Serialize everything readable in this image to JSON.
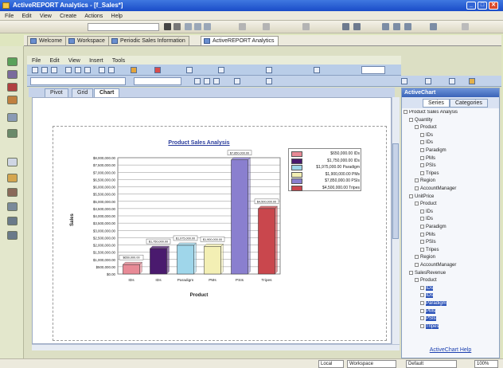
{
  "window": {
    "title": "ActiveREPORT Analytics - [f_Sales*]",
    "controls": [
      "_",
      "□",
      "✕"
    ]
  },
  "menubar": [
    "File",
    "Edit",
    "View",
    "Create",
    "Actions",
    "Help"
  ],
  "doc_tabs": [
    {
      "label": "Welcome"
    },
    {
      "label": "Workspace"
    },
    {
      "label": "Periodic Sales Information"
    },
    {
      "label": "ActiveREPORT Analytics"
    }
  ],
  "inner_menu": [
    "File",
    "Edit",
    "View",
    "Insert",
    "Tools"
  ],
  "view_tabs": [
    "Pivot",
    "Grid",
    "Chart"
  ],
  "active_view": "Chart",
  "right_panel": {
    "title": "ActiveChart",
    "tabs": [
      "Series",
      "Categories"
    ],
    "link": "ActiveChart Help"
  },
  "tree": [
    {
      "label": "Product Sales Analysis",
      "level": 0,
      "sel": false
    },
    {
      "label": "Quantity",
      "level": 1,
      "sel": false
    },
    {
      "label": "Product",
      "level": 2,
      "sel": false
    },
    {
      "label": "IDs",
      "level": 3,
      "sel": false
    },
    {
      "label": "IDs",
      "level": 3,
      "sel": false
    },
    {
      "label": "Paradigm",
      "level": 3,
      "sel": false
    },
    {
      "label": "PMs",
      "level": 3,
      "sel": false
    },
    {
      "label": "PSIs",
      "level": 3,
      "sel": false
    },
    {
      "label": "Tripes",
      "level": 3,
      "sel": false
    },
    {
      "label": "Region",
      "level": 2,
      "sel": false
    },
    {
      "label": "AccountManager",
      "level": 2,
      "sel": false
    },
    {
      "label": "UnitPrice",
      "level": 1,
      "sel": false
    },
    {
      "label": "Product",
      "level": 2,
      "sel": false
    },
    {
      "label": "IDs",
      "level": 3,
      "sel": false
    },
    {
      "label": "IDs",
      "level": 3,
      "sel": false
    },
    {
      "label": "Paradigm",
      "level": 3,
      "sel": false
    },
    {
      "label": "PMs",
      "level": 3,
      "sel": false
    },
    {
      "label": "PSIs",
      "level": 3,
      "sel": false
    },
    {
      "label": "Tripes",
      "level": 3,
      "sel": false
    },
    {
      "label": "Region",
      "level": 2,
      "sel": false
    },
    {
      "label": "AccountManager",
      "level": 2,
      "sel": false
    },
    {
      "label": "SalesRevenue",
      "level": 1,
      "sel": false
    },
    {
      "label": "Product",
      "level": 2,
      "sel": false
    },
    {
      "label": "IDs",
      "level": 3,
      "sel": true
    },
    {
      "label": "IDs",
      "level": 3,
      "sel": true
    },
    {
      "label": "Paradigm",
      "level": 3,
      "sel": true
    },
    {
      "label": "PMs",
      "level": 3,
      "sel": true
    },
    {
      "label": "PSIs",
      "level": 3,
      "sel": true
    },
    {
      "label": "Tripes",
      "level": 3,
      "sel": true
    }
  ],
  "status": {
    "combo1": "Local",
    "combo2": "Workspace",
    "combo3": "Default",
    "combo4": "100%"
  },
  "colors": {
    "accent": "#2b52b8",
    "panel_title": "#3a64b8"
  },
  "chart_data": {
    "type": "bar",
    "title": "Product Sales Analysis",
    "xlabel": "Product",
    "ylabel": "Sales",
    "ylim": [
      0,
      8000000
    ],
    "yticks": [
      "$0.00",
      "$500,000.00",
      "$1,000,000.00",
      "$1,500,000.00",
      "$2,000,000.00",
      "$2,500,000.00",
      "$3,000,000.00",
      "$3,500,000.00",
      "$4,000,000.00",
      "$4,500,000.00",
      "$5,000,000.00",
      "$5,500,000.00",
      "$6,000,000.00",
      "$6,500,000.00",
      "$7,000,000.00",
      "$7,500,000.00",
      "$8,000,000.00"
    ],
    "categories": [
      "IDs",
      "IDs",
      "Paradigm",
      "PMs",
      "PSIs",
      "Tripes"
    ],
    "values": [
      650000,
      1750000,
      1975000,
      1900000,
      7850000,
      4500000
    ],
    "data_labels": [
      "$650,000.00",
      "$1,750,000.00",
      "$1,975,000.00",
      "$1,900,000.00",
      "$7,850,000.00",
      "$4,500,000.00"
    ],
    "bar_colors": [
      "#e88a96",
      "#4a1a6e",
      "#9fd6ea",
      "#f3efb4",
      "#8a7fcf",
      "#c9474d"
    ],
    "legend": [
      {
        "label": "$650,000.00 IDs",
        "color": "#e88a96"
      },
      {
        "label": "$1,750,000.00 IDs",
        "color": "#4a1a6e"
      },
      {
        "label": "$1,975,000.00 Paradigm",
        "color": "#9fd6ea"
      },
      {
        "label": "$1,900,000.00 PMs",
        "color": "#f3efb4"
      },
      {
        "label": "$7,850,000.00 PSIs",
        "color": "#8a7fcf"
      },
      {
        "label": "$4,500,000.00 Tripes",
        "color": "#c9474d"
      }
    ],
    "legend_position": "right",
    "grid": true
  }
}
